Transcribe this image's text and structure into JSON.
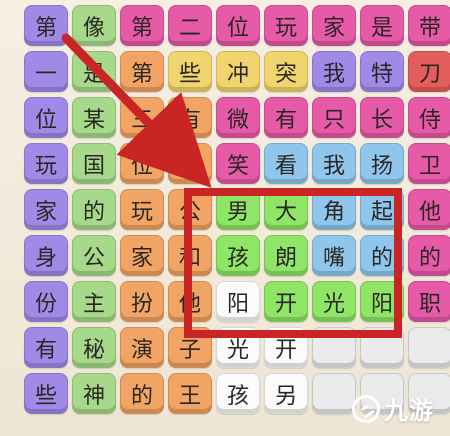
{
  "grid": [
    [
      {
        "text": "第",
        "color": "purple"
      },
      {
        "text": "像",
        "color": "green"
      },
      {
        "text": "第",
        "color": "pink"
      },
      {
        "text": "二",
        "color": "pink"
      },
      {
        "text": "位",
        "color": "pink"
      },
      {
        "text": "玩",
        "color": "pink"
      },
      {
        "text": "家",
        "color": "pink"
      },
      {
        "text": "是",
        "color": "pink"
      },
      {
        "text": "带",
        "color": "pink"
      }
    ],
    [
      {
        "text": "一",
        "color": "purple"
      },
      {
        "text": "是",
        "color": "green"
      },
      {
        "text": "第",
        "color": "orange"
      },
      {
        "text": "些",
        "color": "yellow"
      },
      {
        "text": "冲",
        "color": "yellow"
      },
      {
        "text": "突",
        "color": "yellow"
      },
      {
        "text": "我",
        "color": "purple"
      },
      {
        "text": "特",
        "color": "purple"
      },
      {
        "text": "刀",
        "color": "red"
      }
    ],
    [
      {
        "text": "位",
        "color": "purple"
      },
      {
        "text": "某",
        "color": "green"
      },
      {
        "text": "三",
        "color": "orange"
      },
      {
        "text": "有",
        "color": "orange"
      },
      {
        "text": "微",
        "color": "pink"
      },
      {
        "text": "有",
        "color": "pink"
      },
      {
        "text": "只",
        "color": "pink"
      },
      {
        "text": "长",
        "color": "pink"
      },
      {
        "text": "侍",
        "color": "pink"
      }
    ],
    [
      {
        "text": "玩",
        "color": "purple"
      },
      {
        "text": "国",
        "color": "green"
      },
      {
        "text": "位",
        "color": "orange"
      },
      {
        "text": "王",
        "color": "orange"
      },
      {
        "text": "笑",
        "color": "pink"
      },
      {
        "text": "看",
        "color": "blue"
      },
      {
        "text": "我",
        "color": "blue"
      },
      {
        "text": "扬",
        "color": "blue"
      },
      {
        "text": "卫",
        "color": "pink"
      }
    ],
    [
      {
        "text": "家",
        "color": "purple"
      },
      {
        "text": "的",
        "color": "green"
      },
      {
        "text": "玩",
        "color": "orange"
      },
      {
        "text": "公",
        "color": "orange"
      },
      {
        "text": "男",
        "color": "lime"
      },
      {
        "text": "大",
        "color": "lime"
      },
      {
        "text": "角",
        "color": "blue"
      },
      {
        "text": "起",
        "color": "blue"
      },
      {
        "text": "他",
        "color": "pink"
      }
    ],
    [
      {
        "text": "身",
        "color": "purple"
      },
      {
        "text": "公",
        "color": "green"
      },
      {
        "text": "家",
        "color": "orange"
      },
      {
        "text": "和",
        "color": "orange"
      },
      {
        "text": "孩",
        "color": "lime"
      },
      {
        "text": "朗",
        "color": "lime"
      },
      {
        "text": "嘴",
        "color": "blue"
      },
      {
        "text": "的",
        "color": "blue"
      },
      {
        "text": "的",
        "color": "pink"
      }
    ],
    [
      {
        "text": "份",
        "color": "purple"
      },
      {
        "text": "主",
        "color": "green"
      },
      {
        "text": "扮",
        "color": "orange"
      },
      {
        "text": "他",
        "color": "orange"
      },
      {
        "text": "阳",
        "color": "white"
      },
      {
        "text": "开",
        "color": "lime"
      },
      {
        "text": "光",
        "color": "lime"
      },
      {
        "text": "阳",
        "color": "lime"
      },
      {
        "text": "职",
        "color": "pink"
      }
    ],
    [
      {
        "text": "有",
        "color": "purple"
      },
      {
        "text": "秘",
        "color": "green"
      },
      {
        "text": "演",
        "color": "orange"
      },
      {
        "text": "子",
        "color": "orange"
      },
      {
        "text": "光",
        "color": "white"
      },
      {
        "text": "开",
        "color": "white"
      },
      {
        "text": "",
        "color": "light"
      },
      {
        "text": "",
        "color": "light"
      },
      {
        "text": "",
        "color": "light"
      }
    ],
    [
      {
        "text": "些",
        "color": "purple"
      },
      {
        "text": "神",
        "color": "green"
      },
      {
        "text": "的",
        "color": "orange"
      },
      {
        "text": "王",
        "color": "orange"
      },
      {
        "text": "孩",
        "color": "white"
      },
      {
        "text": "另",
        "color": "white"
      },
      {
        "text": "",
        "color": "light"
      },
      {
        "text": "",
        "color": "light"
      },
      {
        "text": "",
        "color": "light"
      }
    ]
  ],
  "watermark": {
    "icon": "gear-swirl-icon",
    "text": "九游"
  },
  "colors": {
    "purple": "#a08ae8",
    "green": "#a7d98b",
    "pink": "#e65aa8",
    "orange": "#f1a463",
    "yellow": "#f0d46d",
    "blue": "#8fc7ec",
    "lime": "#8fe566",
    "white": "#fbfbfb",
    "light": "#e9ebea",
    "red": "#e45d5d",
    "highlight": "#c82524"
  }
}
